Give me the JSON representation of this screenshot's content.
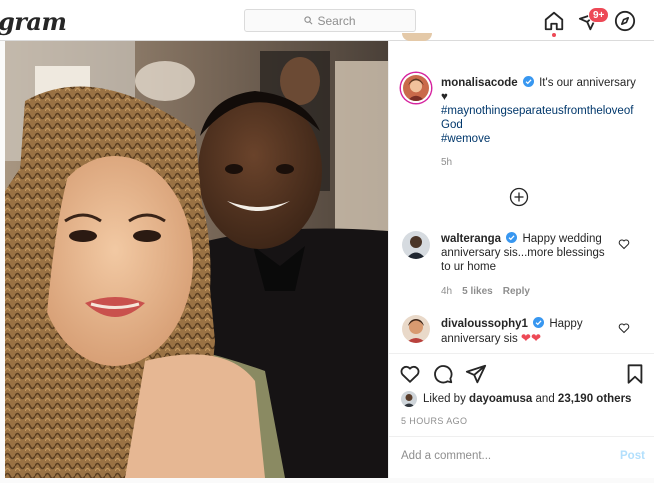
{
  "nav": {
    "logo_text": "gram",
    "search_placeholder": "Search",
    "notification_badge": "9+"
  },
  "post": {
    "author": "monalisacode",
    "caption_text": "It's our anniversary",
    "caption_emoji": "♥",
    "hashtag_1": "#maynothingseparateusfromtheloveofGod",
    "hashtag_2": "#wemove",
    "time_ago": "5h",
    "liked_by_prefix": "Liked by",
    "liked_by_user": "dayoamusa",
    "liked_by_and": "and",
    "like_count": "23,190 others",
    "posted_at": "5 HOURS AGO",
    "add_comment_placeholder": "Add a comment...",
    "post_button": "Post"
  },
  "comments": [
    {
      "username": "walteranga",
      "text": "Happy wedding anniversary sis...more blessings to ur home",
      "time": "4h",
      "likes": "5 likes",
      "reply": "Reply"
    },
    {
      "username": "divaloussophy1",
      "text": "Happy anniversary sis",
      "hearts": "❤❤"
    }
  ],
  "colors": {
    "accent_link": "#00376b",
    "verified_blue": "#3897f0",
    "badge_red": "#ed4956",
    "muted": "#8e8e8e"
  },
  "icons": [
    "search-icon",
    "home-icon",
    "direct-icon",
    "explore-icon",
    "verified-icon",
    "add-circle-icon",
    "heart-icon",
    "comment-icon",
    "share-icon",
    "bookmark-icon"
  ]
}
